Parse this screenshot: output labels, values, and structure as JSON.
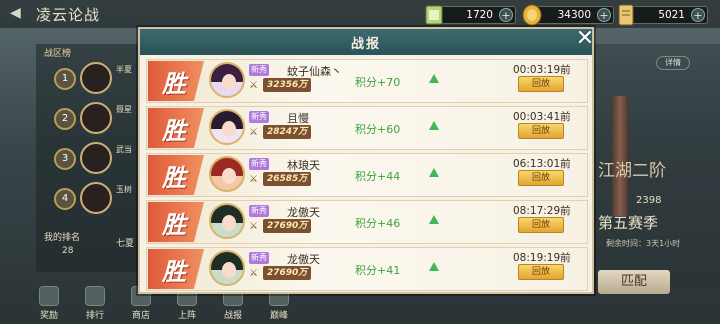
{
  "page": {
    "title": "凌云论战"
  },
  "currencies": [
    {
      "name": "ticket-icon",
      "value": "1720",
      "color": "#b8d27a"
    },
    {
      "name": "gold-coin-icon",
      "value": "34300",
      "color": "#e9b13a"
    },
    {
      "name": "scroll-icon",
      "value": "5021",
      "color": "#e7c873"
    }
  ],
  "left": {
    "rank_tag": "战区榜",
    "rows": [
      {
        "rank": "1",
        "text": "半夏"
      },
      {
        "rank": "2",
        "text": "聂星"
      },
      {
        "rank": "3",
        "text": "武当"
      },
      {
        "rank": "4",
        "text": "玉树"
      }
    ],
    "my_rank_label": "我的排名",
    "my_rank_value": "28",
    "my_rank_name": "七夏"
  },
  "right": {
    "detail": "详情",
    "tier": "江湖二阶",
    "score": "2398",
    "season": "第五赛季",
    "remain": "剩余时间：3天1小时",
    "match": "匹配"
  },
  "nav": [
    "奖励",
    "排行",
    "商店",
    "上阵",
    "战报",
    "巅峰"
  ],
  "modal": {
    "title": "战报",
    "win_text": "胜",
    "new_tag": "新秀",
    "replay_label": "回放",
    "records": [
      {
        "name": "蚊子仙森丶",
        "power": "32356万",
        "score": "积分+70",
        "time": "00:03:19前"
      },
      {
        "name": "且慢",
        "power": "28247万",
        "score": "积分+60",
        "time": "00:03:41前"
      },
      {
        "name": "林琅天",
        "power": "26585万",
        "score": "积分+44",
        "time": "06:13:01前"
      },
      {
        "name": "龙傲天",
        "power": "27690万",
        "score": "积分+46",
        "time": "08:17:29前"
      },
      {
        "name": "龙傲天",
        "power": "27690万",
        "score": "积分+41",
        "time": "08:19:19前"
      }
    ]
  }
}
